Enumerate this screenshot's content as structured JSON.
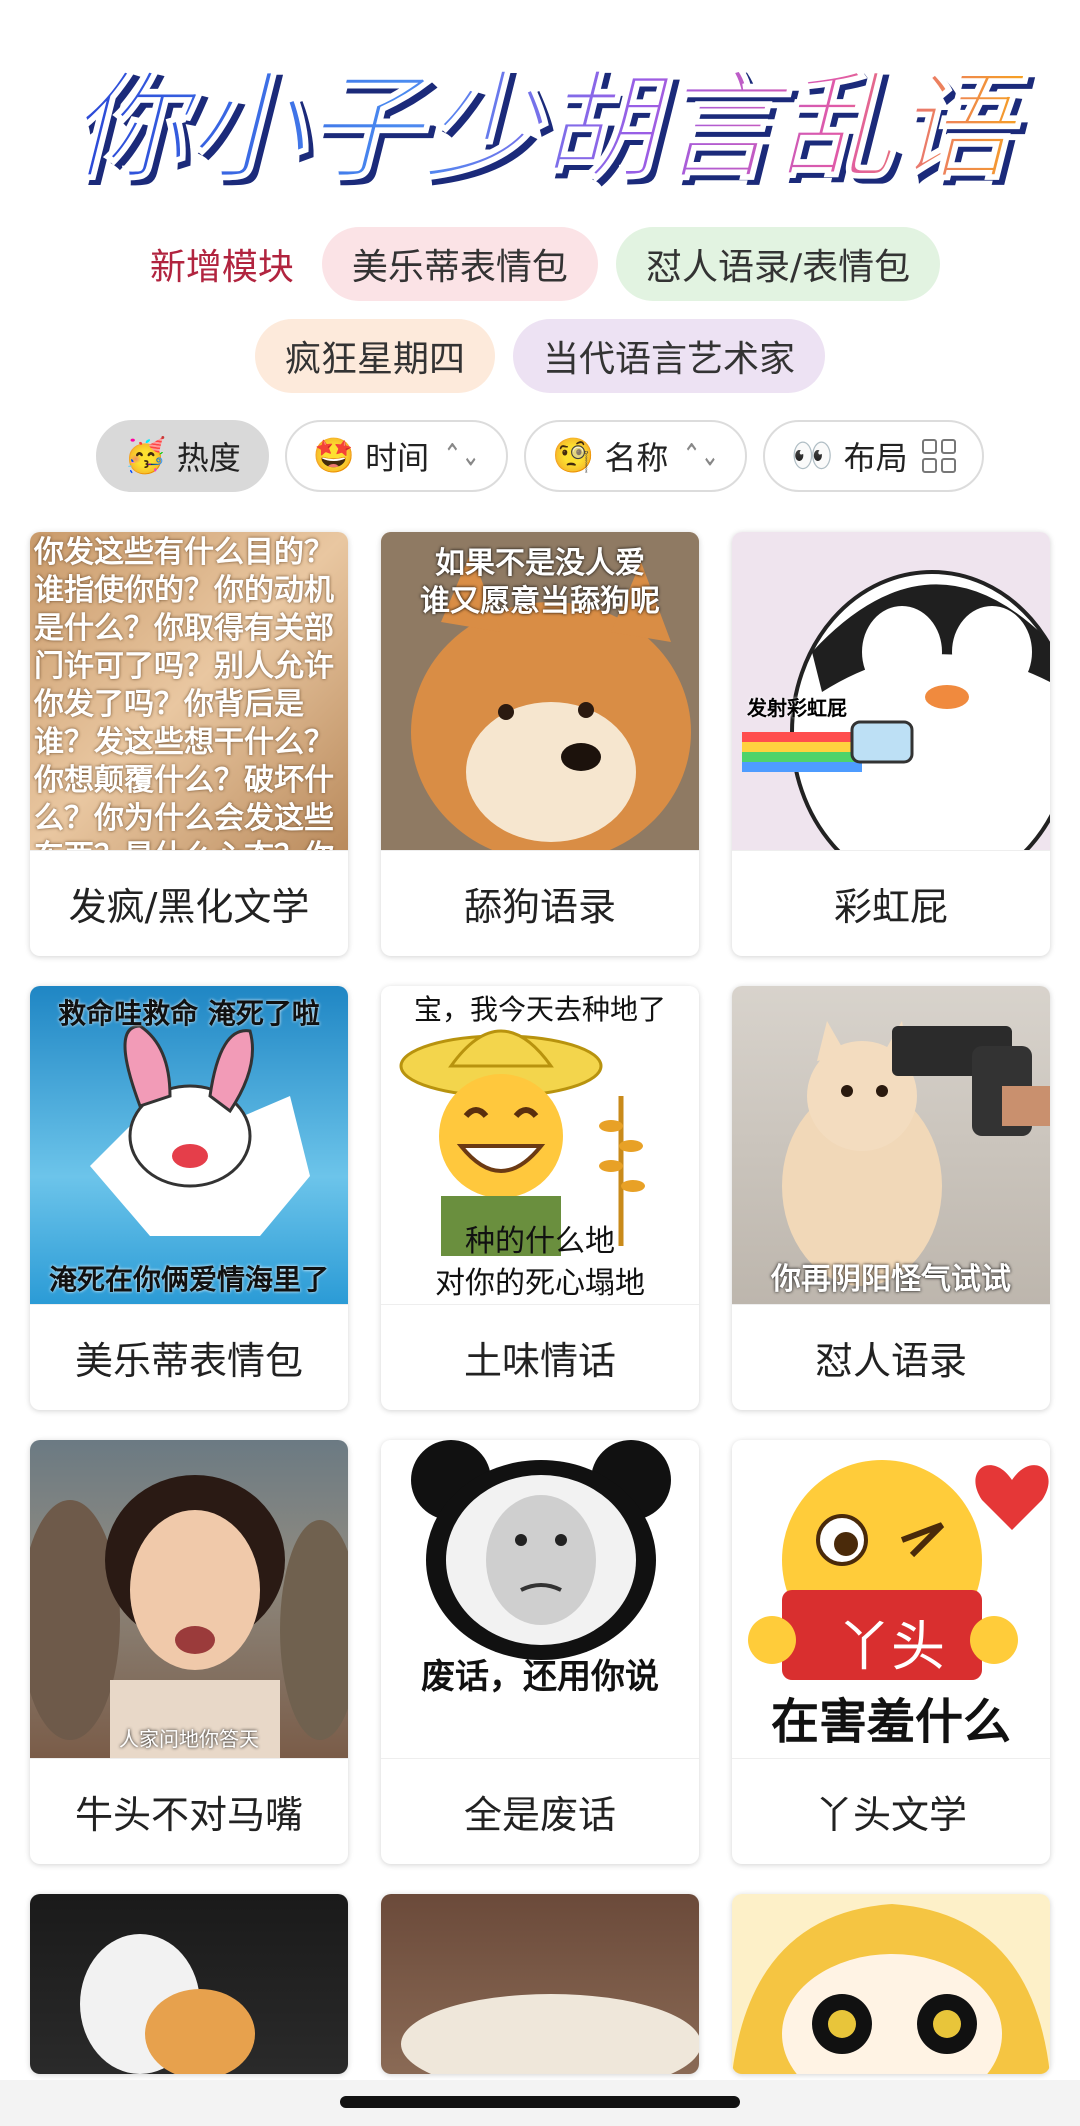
{
  "banner": {
    "title": "你小子少胡言乱语"
  },
  "modules": {
    "label": "新增模块",
    "items": [
      {
        "label": "美乐蒂表情包",
        "color": "#fbe3e6"
      },
      {
        "label": "怼人语录/表情包",
        "color": "#e2f3e1"
      },
      {
        "label": "疯狂星期四",
        "color": "#fdeadb"
      },
      {
        "label": "当代语言艺术家",
        "color": "#ede2f3"
      }
    ]
  },
  "sort": {
    "heat": {
      "emoji": "🥳",
      "label": "热度"
    },
    "time": {
      "emoji": "🤩",
      "label": "时间"
    },
    "name": {
      "emoji": "🧐",
      "label": "名称"
    },
    "layout": {
      "emoji": "👀",
      "label": "布局"
    }
  },
  "cards": [
    {
      "label": "发疯/黑化文学",
      "caption": "你发这些有什么目的？谁指使你的？你的动机是什么？你取得有关部门许可了吗？别人允许你发了吗？你背后是谁？发这些想干什么？你想颠覆什么？破坏什么？你为什么会发这些东西？是什么心态？你用"
    },
    {
      "label": "舔狗语录",
      "caption_top": "如果不是没人爱",
      "caption_top2": "谁又愿意当舔狗呢"
    },
    {
      "label": "彩虹屁",
      "caption": "发射彩虹屁"
    },
    {
      "label": "美乐蒂表情包",
      "caption_top": "救命哇救命 淹死了啦",
      "caption_bot": "淹死在你俩爱情海里了"
    },
    {
      "label": "土味情话",
      "caption_top": "宝，我今天去种地了",
      "caption_bot": "种的什么地",
      "caption_bot2": "对你的死心塌地"
    },
    {
      "label": "怼人语录",
      "caption_bot": "你再阴阳怪气试试"
    },
    {
      "label": "牛头不对马嘴",
      "caption_bot": "人家问地你答天"
    },
    {
      "label": "全是废话",
      "caption_bot": "废话，还用你说"
    },
    {
      "label": "丫头文学",
      "caption_mid": "丫头",
      "caption_bot": "在害羞什么"
    }
  ],
  "colors": {
    "accent": "#b1243f"
  }
}
